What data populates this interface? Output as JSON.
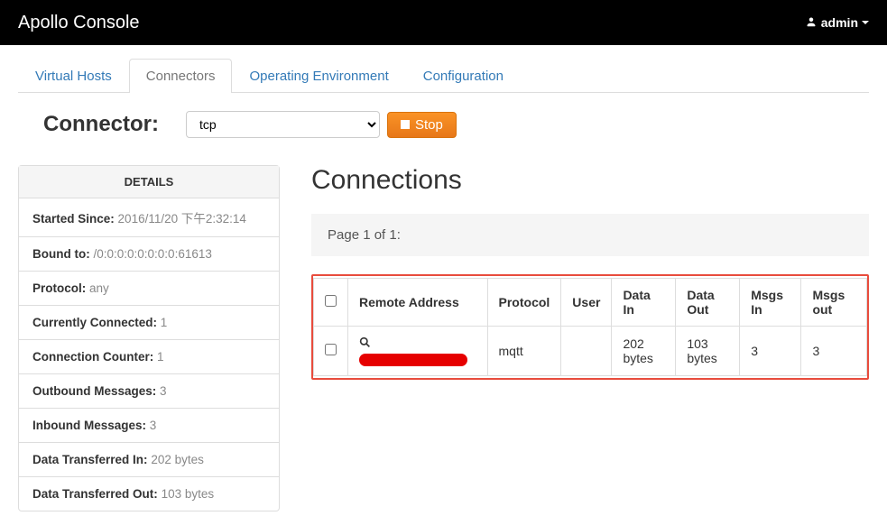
{
  "navbar": {
    "brand": "Apollo Console",
    "user": "admin"
  },
  "tabs": [
    {
      "label": "Virtual Hosts",
      "active": false
    },
    {
      "label": "Connectors",
      "active": true
    },
    {
      "label": "Operating Environment",
      "active": false
    },
    {
      "label": "Configuration",
      "active": false
    }
  ],
  "connector": {
    "label": "Connector:",
    "selected": "tcp",
    "stopLabel": "Stop"
  },
  "details": {
    "header": "DETAILS",
    "items": [
      {
        "label": "Started Since:",
        "value": "2016/11/20 下午2:32:14"
      },
      {
        "label": "Bound to:",
        "value": "/0:0:0:0:0:0:0:0:61613"
      },
      {
        "label": "Protocol:",
        "value": "any"
      },
      {
        "label": "Currently Connected:",
        "value": "1"
      },
      {
        "label": "Connection Counter:",
        "value": "1"
      },
      {
        "label": "Outbound Messages:",
        "value": "3"
      },
      {
        "label": "Inbound Messages:",
        "value": "3"
      },
      {
        "label": "Data Transferred In:",
        "value": "202 bytes"
      },
      {
        "label": "Data Transferred Out:",
        "value": "103 bytes"
      }
    ]
  },
  "connections": {
    "title": "Connections",
    "pageInfo": "Page 1 of 1:",
    "columns": [
      "",
      "Remote Address",
      "Protocol",
      "User",
      "Data In",
      "Data Out",
      "Msgs In",
      "Msgs out"
    ],
    "rows": [
      {
        "remoteAddress": "",
        "protocol": "mqtt",
        "user": "",
        "dataIn": "202 bytes",
        "dataOut": "103 bytes",
        "msgsIn": "3",
        "msgsOut": "3"
      }
    ]
  }
}
